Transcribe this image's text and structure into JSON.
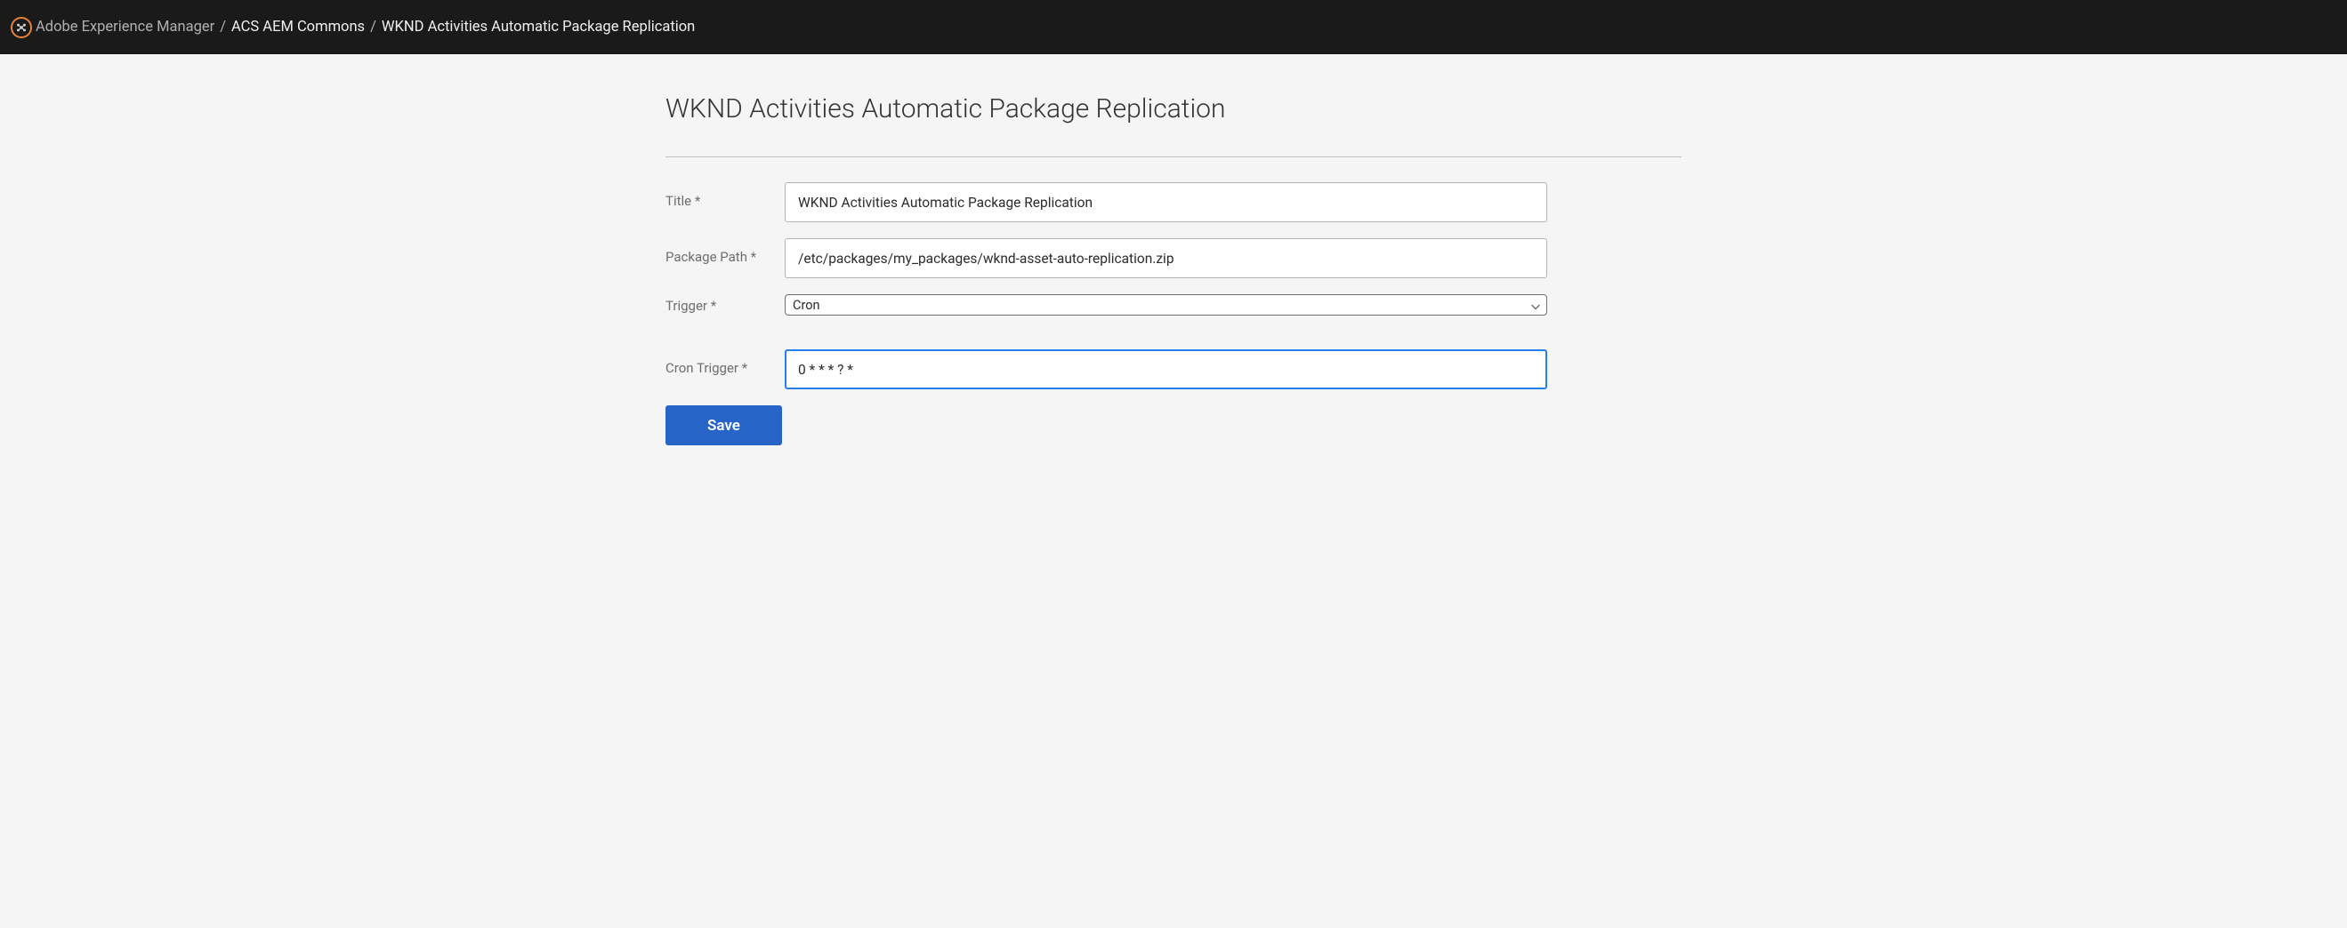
{
  "header": {
    "breadcrumb": [
      {
        "label": "Adobe Experience Manager",
        "muted": true
      },
      {
        "label": "ACS AEM Commons",
        "muted": false
      },
      {
        "label": "WKND Activities Automatic Package Replication",
        "muted": false
      }
    ]
  },
  "main": {
    "title": "WKND Activities Automatic Package Replication",
    "form": {
      "title": {
        "label": "Title *",
        "value": "WKND Activities Automatic Package Replication"
      },
      "package_path": {
        "label": "Package Path *",
        "value": "/etc/packages/my_packages/wknd-asset-auto-replication.zip"
      },
      "trigger": {
        "label": "Trigger *",
        "value": "Cron"
      },
      "cron_trigger": {
        "label": "Cron Trigger *",
        "value": "0 * * * ? *"
      },
      "save_label": "Save"
    }
  }
}
